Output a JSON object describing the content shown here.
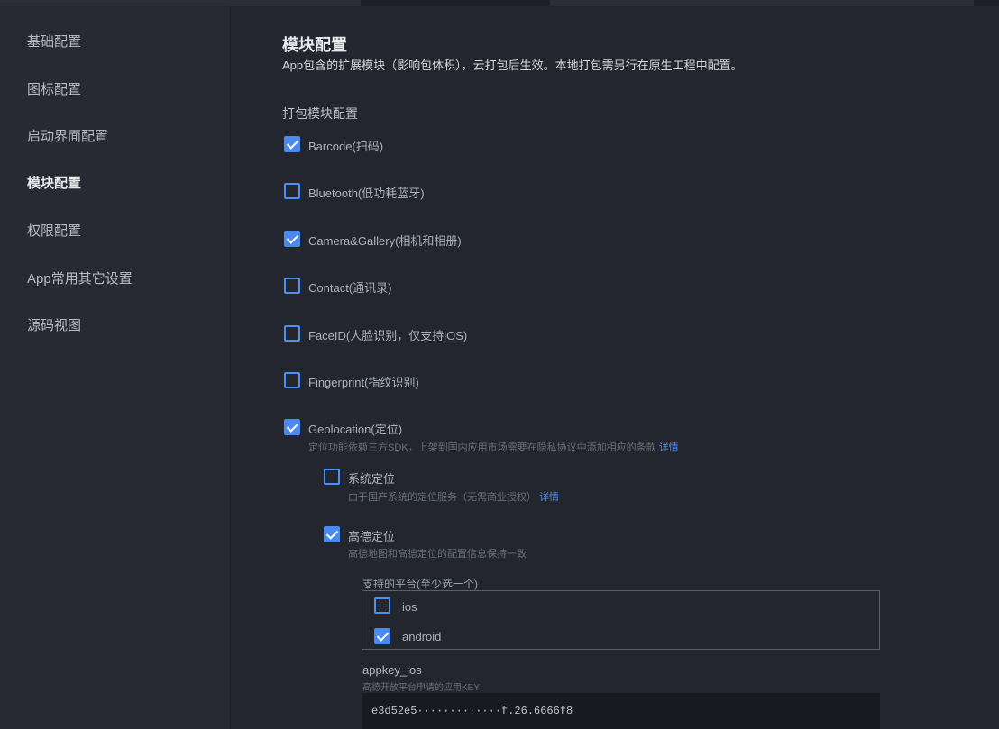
{
  "sidebar": {
    "items": [
      {
        "label": "基础配置"
      },
      {
        "label": "图标配置"
      },
      {
        "label": "启动界面配置"
      },
      {
        "label": "模块配置"
      },
      {
        "label": "权限配置"
      },
      {
        "label": "App常用其它设置"
      },
      {
        "label": "源码视图"
      }
    ],
    "active": "模块配置"
  },
  "main": {
    "title": "模块配置",
    "description": "App包含的扩展模块（影响包体积），云打包后生效。本地打包需另行在原生工程中配置。",
    "section_title": "打包模块配置",
    "modules": [
      {
        "label": "Barcode(扫码)",
        "checked": true
      },
      {
        "label": "Bluetooth(低功耗蓝牙)",
        "checked": false
      },
      {
        "label": "Camera&Gallery(相机和相册)",
        "checked": true
      },
      {
        "label": "Contact(通讯录)",
        "checked": false
      },
      {
        "label": "FaceID(人脸识别，仅支持iOS)",
        "checked": false
      },
      {
        "label": "Fingerprint(指纹识别)",
        "checked": false
      },
      {
        "label": "Geolocation(定位)",
        "checked": true,
        "hint": "定位功能依赖三方SDK，上架到国内应用市场需要在隐私协议中添加相应的条款",
        "hint_link": "详情"
      }
    ],
    "geolocation_options": [
      {
        "label": "系统定位",
        "checked": false,
        "hint": "由于国产系统的定位服务（无需商业授权）",
        "hint_link": "详情"
      },
      {
        "label": "高德定位",
        "checked": true,
        "hint": "高德地图和高德定位的配置信息保持一致"
      }
    ],
    "platform_group_label": "支持的平台(至少选一个)",
    "platforms": [
      {
        "label": "ios",
        "checked": false
      },
      {
        "label": "android",
        "checked": true
      }
    ],
    "appkey": {
      "label": "appkey_ios",
      "hint": "高德开放平台申请的应用KEY",
      "value": "e3d52e5·············f.26.6666f8"
    }
  },
  "colors": {
    "background": "#23262e",
    "sidebar": "#272a32",
    "accent": "#4a8af0"
  }
}
